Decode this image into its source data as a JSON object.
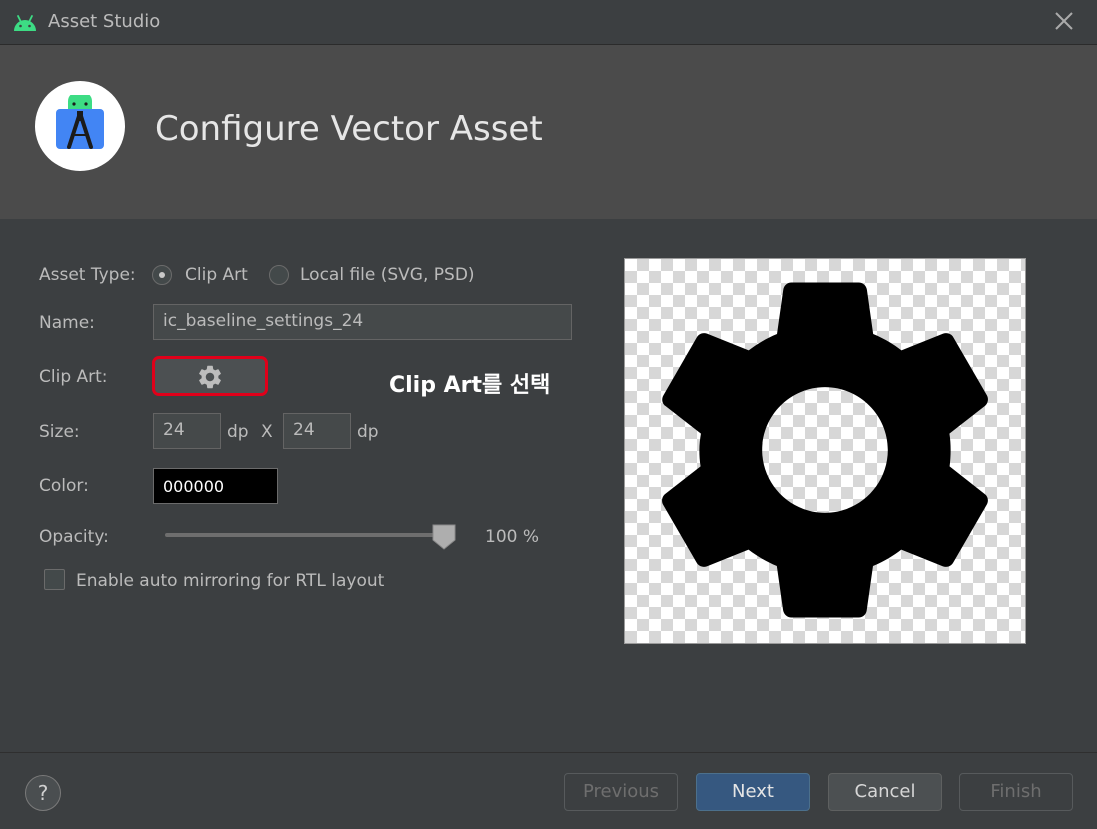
{
  "window": {
    "title": "Asset Studio",
    "close_icon": "close-icon"
  },
  "header": {
    "title": "Configure Vector Asset"
  },
  "form": {
    "asset_type_label": "Asset Type:",
    "asset_type_options": [
      {
        "label": "Clip Art",
        "checked": true
      },
      {
        "label": "Local file (SVG, PSD)",
        "checked": false
      }
    ],
    "name_label": "Name:",
    "name_value": "ic_baseline_settings_24",
    "clip_art_label": "Clip Art:",
    "clip_art_icon": "gear-icon",
    "annotation": "Clip Art를 선택",
    "size_label": "Size:",
    "width_value": "24",
    "height_value": "24",
    "unit": "dp",
    "size_separator": "X",
    "color_label": "Color:",
    "color_value": "000000",
    "opacity_label": "Opacity:",
    "opacity_value": "100 %",
    "opacity_level": 1.0,
    "mirroring_label": "Enable auto mirroring for RTL layout",
    "mirroring_checked": false
  },
  "preview": {
    "icon": "gear-icon"
  },
  "footer": {
    "help_label": "?",
    "previous_label": "Previous",
    "next_label": "Next",
    "cancel_label": "Cancel",
    "finish_label": "Finish"
  },
  "colors": {
    "background": "#3c3f41",
    "header": "#4b4b4b",
    "primary_button": "#365880",
    "highlight": "#e0001a"
  }
}
